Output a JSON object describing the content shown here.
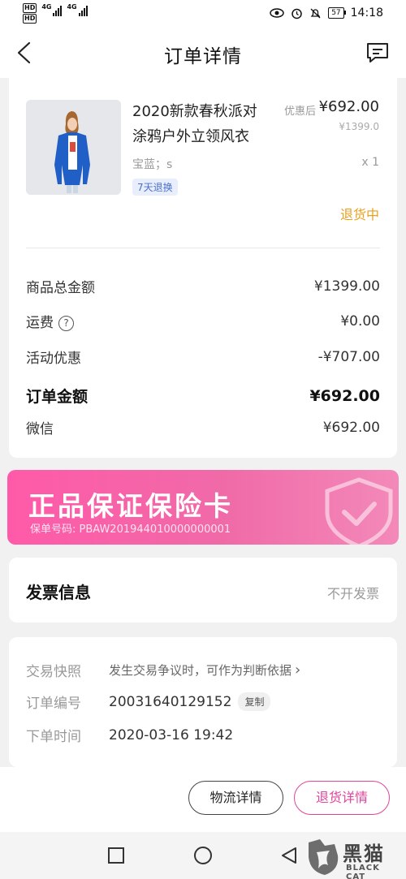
{
  "status_bar": {
    "hd1": "HD",
    "hd2": "HD",
    "net1": "4G",
    "net2": "4G",
    "battery": "57",
    "time": "14:18"
  },
  "header": {
    "title": "订单详情"
  },
  "product": {
    "name_line1": "2020新款春秋派对",
    "name_line2": "涂鸦户外立领风衣",
    "price_label": "优惠后",
    "price": "¥692.00",
    "original_price": "¥1399.0",
    "spec": "宝蓝；s",
    "quantity": "x 1",
    "return_tag": "7天退换",
    "status": "退货中",
    "status_color": "#e8a020"
  },
  "summary": {
    "rows": [
      {
        "label": "商品总金额",
        "value": "¥1399.00"
      },
      {
        "label": "运费",
        "value": "¥0.00"
      },
      {
        "label": "活动优惠",
        "value": "-¥707.00"
      },
      {
        "label": "订单金额",
        "value": "¥692.00"
      },
      {
        "label": "微信",
        "value": "¥692.00"
      }
    ],
    "help_symbol": "?"
  },
  "insurance": {
    "title": "正品保证保险卡",
    "number_line": "保单号码: PBAW201944010000000001",
    "accent": "#ff5aa9"
  },
  "invoice": {
    "title": "发票信息",
    "value": "不开发票"
  },
  "order_info": {
    "snapshot_label": "交易快照",
    "snapshot_value": "发生交易争议时，可作为判断依据",
    "snapshot_arrow": "›",
    "order_no_label": "订单编号",
    "order_no": "20031640129152",
    "copy_label": "复制",
    "time_label": "下单时间",
    "time": "2020-03-16 19:42"
  },
  "actions": {
    "logistics": "物流详情",
    "return_detail": "退货详情",
    "accent": "#e0449a"
  },
  "watermark": {
    "text": "黑猫",
    "sub": "BLACK CAT"
  }
}
